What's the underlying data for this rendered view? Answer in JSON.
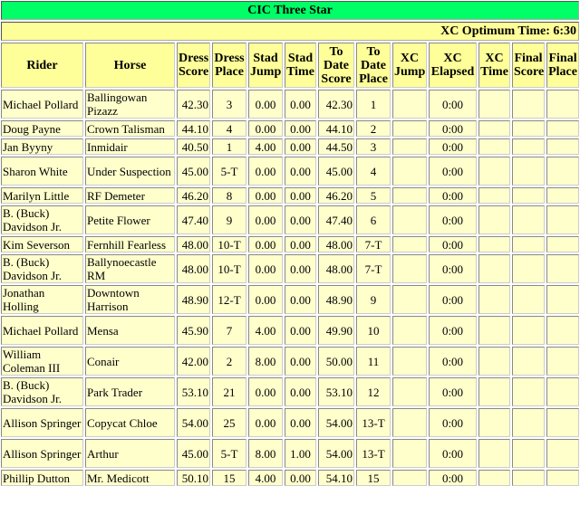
{
  "title": "CIC Three Star",
  "optimum_time_label": "XC Optimum Time: 6:30",
  "colors": {
    "title_bg": "#00ff66",
    "header_bg": "#ffff99",
    "cell_bg": "#ffffcc"
  },
  "columns": [
    "Rider",
    "Horse",
    "Dress Score",
    "Dress Place",
    "Stad Jump",
    "Stad Time",
    "To Date Score",
    "To Date Place",
    "XC Jump",
    "XC Elapsed",
    "XC Time",
    "Final Score",
    "Final Place"
  ],
  "rows": [
    {
      "rider": "Michael Pollard",
      "horse": "Ballingowan Pizazz",
      "dress_score": "42.30",
      "dress_place": "3",
      "stad_jump": "0.00",
      "stad_time": "0.00",
      "to_date_score": "42.30",
      "to_date_place": "1",
      "xc_jump": "",
      "xc_elapsed": "0:00",
      "xc_time": "",
      "final_score": "",
      "final_place": ""
    },
    {
      "rider": "Doug Payne",
      "horse": "Crown Talisman",
      "dress_score": "44.10",
      "dress_place": "4",
      "stad_jump": "0.00",
      "stad_time": "0.00",
      "to_date_score": "44.10",
      "to_date_place": "2",
      "xc_jump": "",
      "xc_elapsed": "0:00",
      "xc_time": "",
      "final_score": "",
      "final_place": ""
    },
    {
      "rider": "Jan Byyny",
      "horse": "Inmidair",
      "dress_score": "40.50",
      "dress_place": "1",
      "stad_jump": "4.00",
      "stad_time": "0.00",
      "to_date_score": "44.50",
      "to_date_place": "3",
      "xc_jump": "",
      "xc_elapsed": "0:00",
      "xc_time": "",
      "final_score": "",
      "final_place": ""
    },
    {
      "rider": "Sharon White",
      "horse": "Under Suspection",
      "dress_score": "45.00",
      "dress_place": "5-T",
      "stad_jump": "0.00",
      "stad_time": "0.00",
      "to_date_score": "45.00",
      "to_date_place": "4",
      "xc_jump": "",
      "xc_elapsed": "0:00",
      "xc_time": "",
      "final_score": "",
      "final_place": ""
    },
    {
      "rider": "Marilyn Little",
      "horse": "RF Demeter",
      "dress_score": "46.20",
      "dress_place": "8",
      "stad_jump": "0.00",
      "stad_time": "0.00",
      "to_date_score": "46.20",
      "to_date_place": "5",
      "xc_jump": "",
      "xc_elapsed": "0:00",
      "xc_time": "",
      "final_score": "",
      "final_place": ""
    },
    {
      "rider": "B. (Buck) Davidson Jr.",
      "horse": "Petite Flower",
      "dress_score": "47.40",
      "dress_place": "9",
      "stad_jump": "0.00",
      "stad_time": "0.00",
      "to_date_score": "47.40",
      "to_date_place": "6",
      "xc_jump": "",
      "xc_elapsed": "0:00",
      "xc_time": "",
      "final_score": "",
      "final_place": ""
    },
    {
      "rider": "Kim Severson",
      "horse": "Fernhill Fearless",
      "dress_score": "48.00",
      "dress_place": "10-T",
      "stad_jump": "0.00",
      "stad_time": "0.00",
      "to_date_score": "48.00",
      "to_date_place": "7-T",
      "xc_jump": "",
      "xc_elapsed": "0:00",
      "xc_time": "",
      "final_score": "",
      "final_place": ""
    },
    {
      "rider": "B. (Buck) Davidson Jr.",
      "horse": "Ballynoecastle RM",
      "dress_score": "48.00",
      "dress_place": "10-T",
      "stad_jump": "0.00",
      "stad_time": "0.00",
      "to_date_score": "48.00",
      "to_date_place": "7-T",
      "xc_jump": "",
      "xc_elapsed": "0:00",
      "xc_time": "",
      "final_score": "",
      "final_place": ""
    },
    {
      "rider": "Jonathan Holling",
      "horse": "Downtown Harrison",
      "dress_score": "48.90",
      "dress_place": "12-T",
      "stad_jump": "0.00",
      "stad_time": "0.00",
      "to_date_score": "48.90",
      "to_date_place": "9",
      "xc_jump": "",
      "xc_elapsed": "0:00",
      "xc_time": "",
      "final_score": "",
      "final_place": ""
    },
    {
      "rider": "Michael Pollard",
      "horse": "Mensa",
      "dress_score": "45.90",
      "dress_place": "7",
      "stad_jump": "4.00",
      "stad_time": "0.00",
      "to_date_score": "49.90",
      "to_date_place": "10",
      "xc_jump": "",
      "xc_elapsed": "0:00",
      "xc_time": "",
      "final_score": "",
      "final_place": ""
    },
    {
      "rider": "William Coleman III",
      "horse": "Conair",
      "dress_score": "42.00",
      "dress_place": "2",
      "stad_jump": "8.00",
      "stad_time": "0.00",
      "to_date_score": "50.00",
      "to_date_place": "11",
      "xc_jump": "",
      "xc_elapsed": "0:00",
      "xc_time": "",
      "final_score": "",
      "final_place": ""
    },
    {
      "rider": "B. (Buck) Davidson Jr.",
      "horse": "Park Trader",
      "dress_score": "53.10",
      "dress_place": "21",
      "stad_jump": "0.00",
      "stad_time": "0.00",
      "to_date_score": "53.10",
      "to_date_place": "12",
      "xc_jump": "",
      "xc_elapsed": "0:00",
      "xc_time": "",
      "final_score": "",
      "final_place": ""
    },
    {
      "rider": "Allison Springer",
      "horse": "Copycat Chloe",
      "dress_score": "54.00",
      "dress_place": "25",
      "stad_jump": "0.00",
      "stad_time": "0.00",
      "to_date_score": "54.00",
      "to_date_place": "13-T",
      "xc_jump": "",
      "xc_elapsed": "0:00",
      "xc_time": "",
      "final_score": "",
      "final_place": ""
    },
    {
      "rider": "Allison Springer",
      "horse": "Arthur",
      "dress_score": "45.00",
      "dress_place": "5-T",
      "stad_jump": "8.00",
      "stad_time": "1.00",
      "to_date_score": "54.00",
      "to_date_place": "13-T",
      "xc_jump": "",
      "xc_elapsed": "0:00",
      "xc_time": "",
      "final_score": "",
      "final_place": ""
    },
    {
      "rider": "Phillip Dutton",
      "horse": "Mr. Medicott",
      "dress_score": "50.10",
      "dress_place": "15",
      "stad_jump": "4.00",
      "stad_time": "0.00",
      "to_date_score": "54.10",
      "to_date_place": "15",
      "xc_jump": "",
      "xc_elapsed": "0:00",
      "xc_time": "",
      "final_score": "",
      "final_place": ""
    }
  ]
}
